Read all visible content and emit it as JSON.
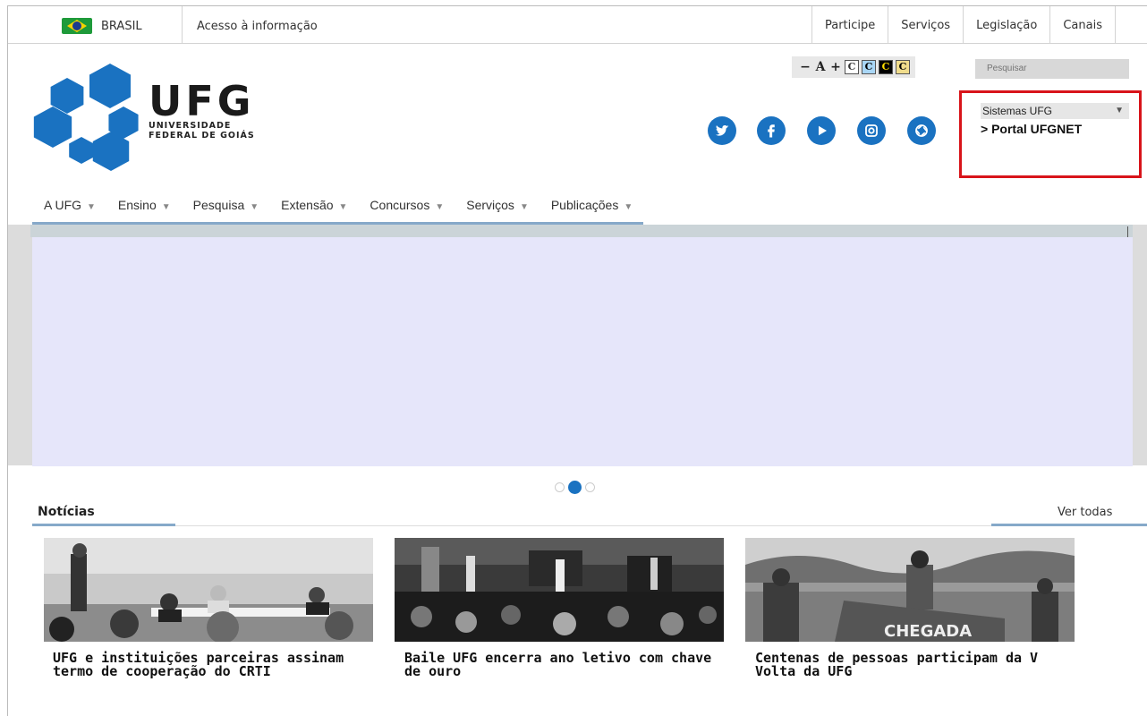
{
  "gov_bar": {
    "brasil_label": "BRASIL",
    "acesso_label": "Acesso à informação",
    "links": [
      "Participe",
      "Serviços",
      "Legislação",
      "Canais"
    ]
  },
  "logo": {
    "title": "UFG",
    "subtitle_line1": "UNIVERSIDADE",
    "subtitle_line2": "FEDERAL DE GOIÁS"
  },
  "accessibility": {
    "decrease": "−",
    "font_label": "A",
    "increase": "+",
    "contrast_options": [
      "C",
      "C",
      "C",
      "C"
    ]
  },
  "social": [
    "twitter-icon",
    "facebook-icon",
    "youtube-icon",
    "instagram-icon",
    "flickr-icon"
  ],
  "search": {
    "placeholder": "Pesquisar"
  },
  "sistemas": {
    "selected": "Sistemas UFG",
    "portal_link": "> Portal UFGNET"
  },
  "main_nav": [
    "A UFG",
    "Ensino",
    "Pesquisa",
    "Extensão",
    "Concursos",
    "Serviços",
    "Publicações"
  ],
  "carousel": {
    "slides": 3,
    "active_index": 1
  },
  "news": {
    "section_title": "Notícias",
    "see_all": "Ver todas",
    "items": [
      {
        "caption": "UFG e instituições parceiras assinam termo de cooperação do CRTI"
      },
      {
        "caption": "Baile UFG encerra ano letivo com chave de ouro"
      },
      {
        "caption": "Centenas de pessoas participam da V Volta da UFG",
        "image_banner_text": "CHEGADA"
      }
    ]
  },
  "colors": {
    "brand_blue": "#1a72c1",
    "highlight_red": "#d8141a",
    "nav_underline": "#86a9c9"
  }
}
